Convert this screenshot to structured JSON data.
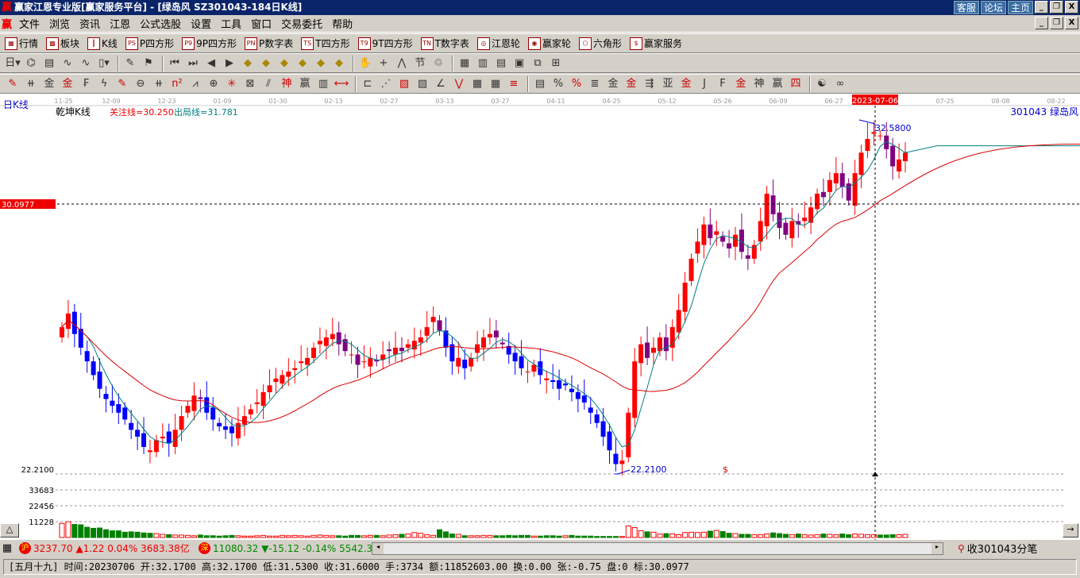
{
  "title": "赢家江恩专业版[赢家服务平台] - [绿岛风   SZ301043-184日K线]",
  "title_links": [
    "客服",
    "论坛",
    "主页"
  ],
  "window_buttons": [
    "_",
    "❐",
    "X"
  ],
  "menu": [
    "文件",
    "浏览",
    "资讯",
    "江恩",
    "公式选股",
    "设置",
    "工具",
    "窗口",
    "交易委托",
    "帮助"
  ],
  "toolbar1": [
    {
      "icon": "PS",
      "label": "P四方形"
    },
    {
      "icon": "P9",
      "label": "9P四方形"
    },
    {
      "icon": "PN",
      "label": "P数字表"
    },
    {
      "icon": "TS",
      "label": "T四方形"
    },
    {
      "icon": "T9",
      "label": "9T四方形"
    },
    {
      "icon": "TN",
      "label": "T数字表"
    },
    {
      "icon": "◎",
      "label": "江恩轮"
    },
    {
      "icon": "◉",
      "label": "赢家轮"
    },
    {
      "icon": "⬡",
      "label": "六角形"
    },
    {
      "icon": "$",
      "label": "赢家服务"
    }
  ],
  "toolbar1_pre": [
    {
      "icon": "▦",
      "label": "行情"
    },
    {
      "icon": "▩",
      "label": "板块"
    },
    {
      "icon": "┃",
      "label": "K线"
    }
  ],
  "toolbar2": [
    {
      "name": "period",
      "g": "日▾"
    },
    {
      "name": "cycle",
      "g": "⌬"
    },
    {
      "name": "doc",
      "g": "▤"
    },
    {
      "name": "ma3",
      "g": "∿"
    },
    {
      "name": "ma9",
      "g": "∿"
    },
    {
      "name": "candle",
      "g": "▯▾"
    },
    {
      "name": "draw",
      "g": "✎"
    },
    {
      "name": "flag",
      "g": "⚑"
    },
    {
      "name": "first",
      "g": "⏮"
    },
    {
      "name": "last",
      "g": "⏭"
    },
    {
      "name": "left",
      "g": "◀"
    },
    {
      "name": "right",
      "g": "▶"
    },
    {
      "name": "d1",
      "g": "◆"
    },
    {
      "name": "d2",
      "g": "◆"
    },
    {
      "name": "d3",
      "g": "◆"
    },
    {
      "name": "d4",
      "g": "◆"
    },
    {
      "name": "d5",
      "g": "◆"
    },
    {
      "name": "d6",
      "g": "◆"
    },
    {
      "name": "hand",
      "g": "✋"
    },
    {
      "name": "cross",
      "g": "+"
    },
    {
      "name": "line",
      "g": "⋀"
    },
    {
      "name": "t1",
      "g": "节"
    },
    {
      "name": "t2",
      "g": "♲"
    },
    {
      "name": "cal",
      "g": "▦"
    },
    {
      "name": "calc",
      "g": "▥"
    },
    {
      "name": "note",
      "g": "▤"
    },
    {
      "name": "save",
      "g": "▣"
    },
    {
      "name": "net",
      "g": "⧉"
    },
    {
      "name": "pc",
      "g": "⊞"
    }
  ],
  "toolbar3": [
    "✎",
    "⧺",
    "金",
    "金",
    "₣",
    "ϟ",
    "✎",
    "⊖",
    "⧺",
    "n²",
    "⩘",
    "⊕",
    "✳",
    "⊠",
    "⫽",
    "神",
    "赢",
    "▥",
    "⟷",
    "⊏",
    "⋰",
    "▨",
    "▧",
    "∠",
    "⋁",
    "▦",
    "▦",
    "≡",
    "▤",
    "%",
    "%",
    "≣",
    "金",
    "金",
    "⇶",
    "亚",
    "金",
    "J",
    "F",
    "金",
    "神",
    "赢",
    "四",
    "☯",
    "∞"
  ],
  "chart": {
    "period_label": "日K线",
    "indicator_name": "乾坤K线",
    "focus_line": "关注线=30.250",
    "exit_line": "出局线=31.781",
    "stock": "301043  绿岛风",
    "dates": [
      "11-25",
      "12-09",
      "12-23",
      "01-09",
      "01-30",
      "02-13",
      "02-27",
      "03-13",
      "03-27",
      "04-11",
      "04-25",
      "05-12",
      "05-26",
      "06-09",
      "06-27",
      "2023-07-06",
      "07-25",
      "08-08",
      "08-22"
    ],
    "cursor_price": "30.0977",
    "high_label": "32.5800",
    "low_label": "22.2100",
    "low_axis": "22.2100",
    "marker": "$",
    "vol_ticks": [
      "33683",
      "22456",
      "11228"
    ],
    "closes": [
      26.5,
      26.9,
      26.3,
      25.9,
      25.5,
      25.1,
      24.7,
      24.4,
      24.2,
      24.0,
      23.8,
      23.5,
      23.3,
      23.0,
      22.9,
      23.2,
      23.3,
      23.1,
      23.5,
      23.9,
      24.2,
      24.5,
      24.4,
      24.0,
      23.8,
      23.6,
      23.5,
      23.4,
      23.7,
      23.9,
      24.1,
      24.3,
      24.6,
      24.8,
      25.0,
      25.1,
      25.2,
      25.3,
      25.5,
      25.6,
      25.9,
      26.1,
      26.2,
      26.3,
      26.0,
      25.8,
      25.7,
      25.4,
      25.5,
      25.6,
      25.5,
      25.7,
      25.8,
      25.9,
      25.8,
      26.0,
      26.1,
      26.2,
      26.5,
      26.8,
      26.4,
      25.9,
      25.5,
      25.6,
      25.3,
      25.6,
      26.0,
      26.2,
      26.3,
      26.2,
      26.0,
      25.7,
      25.5,
      25.3,
      25.2,
      25.4,
      25.1,
      25.0,
      24.9,
      24.7,
      24.8,
      24.6,
      24.4,
      24.3,
      24.0,
      23.7,
      23.3,
      22.9,
      22.5,
      22.6,
      24.0,
      25.5,
      26.0,
      25.6,
      25.9,
      26.2,
      25.8,
      26.5,
      27.0,
      27.8,
      28.5,
      29.0,
      29.5,
      29.1,
      29.3,
      29.0,
      28.8,
      29.2,
      28.7,
      28.5,
      28.9,
      29.6,
      30.4,
      29.8,
      29.4,
      29.2,
      29.6,
      29.5,
      29.7,
      30.0,
      30.4,
      30.3,
      30.8,
      31.0,
      30.6,
      30.2,
      31.0,
      31.6,
      32.0,
      32.2,
      32.1,
      31.7,
      31.2,
      31.4,
      31.6
    ],
    "volumes_k": [
      40,
      45,
      37,
      36,
      29,
      26,
      27,
      22,
      19,
      19,
      15,
      16,
      15,
      13,
      12,
      11,
      9,
      8,
      7,
      7,
      6,
      5,
      7,
      5,
      5,
      4,
      5,
      6,
      5,
      4,
      4,
      5,
      6,
      4,
      4,
      6,
      5,
      6,
      5,
      4,
      6,
      7,
      6,
      5,
      5,
      4,
      6,
      6,
      5,
      6,
      6,
      5,
      7,
      8,
      9,
      10,
      14,
      12,
      8,
      6,
      22,
      16,
      10,
      9,
      5,
      5,
      5,
      6,
      6,
      5,
      5,
      6,
      5,
      6,
      6,
      4,
      4,
      5,
      5,
      4,
      5,
      6,
      4,
      4,
      4,
      3,
      3,
      3,
      3,
      3,
      33,
      28,
      19,
      16,
      15,
      10,
      11,
      10,
      8,
      14,
      15,
      14,
      15,
      18,
      20,
      17,
      12,
      11,
      9,
      9,
      8,
      8,
      10,
      13,
      11,
      9,
      8,
      10,
      8,
      7,
      8,
      10,
      9,
      8,
      10,
      8,
      10,
      9,
      8,
      8,
      7,
      7,
      8,
      8,
      9
    ]
  },
  "status": {
    "sh_badge": "沪",
    "sh": "3237.70 ▲1.22 0.04% 3683.38亿",
    "sz_badge": "深",
    "sz": "11080.32 ▼-15.12 -0.14% 5542.3",
    "feed": "收301043分笔"
  },
  "info": "[五月十九] 时间:20230706 开:32.1700 高:32.1700 低:31.5300 收:31.6000 手:3734 额:11852603.00 换:0.00 张:-0.75 盘:0 标:30.0977",
  "colors": {
    "up": "#ff0000",
    "down": "#0000ff",
    "mid": "#800080",
    "vol_down": "#008000",
    "ma_short": "#008080",
    "ma_long": "#dd0000"
  }
}
